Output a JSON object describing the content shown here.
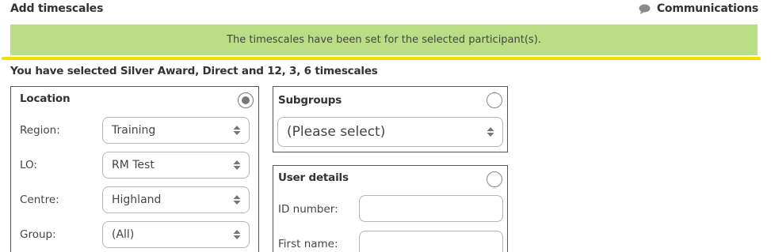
{
  "header": {
    "title": "Add timescales",
    "communications_label": "Communications"
  },
  "banner": {
    "message": "The timescales have been set for the selected participant(s)."
  },
  "selection_summary": "You have selected Silver Award, Direct and 12, 3, 6 timescales",
  "location": {
    "title": "Location",
    "radio_selected": true,
    "fields": [
      {
        "label": "Region:",
        "value": "Training"
      },
      {
        "label": "LO:",
        "value": "RM Test"
      },
      {
        "label": "Centre:",
        "value": "Highland"
      },
      {
        "label": "Group:",
        "value": "(All)"
      }
    ]
  },
  "subgroups": {
    "title": "Subgroups",
    "radio_selected": false,
    "select_value": "(Please select)"
  },
  "user_details": {
    "title": "User details",
    "radio_selected": false,
    "fields": [
      {
        "label": "ID number:",
        "value": ""
      },
      {
        "label": "First name:",
        "value": ""
      }
    ]
  },
  "colors": {
    "banner_bg": "#bade86",
    "divider": "#f2e000"
  },
  "icons": {
    "communications": "speech-bubble-icon",
    "select_arrows": "sort-arrows-icon"
  }
}
